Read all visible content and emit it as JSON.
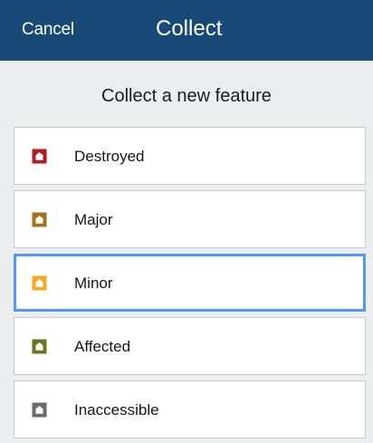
{
  "header": {
    "cancel_label": "Cancel",
    "title": "Collect"
  },
  "subtitle": "Collect a new feature",
  "features": [
    {
      "label": "Destroyed",
      "icon": "house-icon",
      "color": "#b31b24",
      "selected": false
    },
    {
      "label": "Major",
      "icon": "house-icon",
      "color": "#a8701e",
      "selected": false
    },
    {
      "label": "Minor",
      "icon": "house-icon",
      "color": "#f4a91f",
      "selected": true
    },
    {
      "label": "Affected",
      "icon": "house-icon",
      "color": "#6e7224",
      "selected": false
    },
    {
      "label": "Inaccessible",
      "icon": "house-icon",
      "color": "#6a6a6a",
      "selected": false
    }
  ],
  "colors": {
    "navbar": "#174a77",
    "background": "#ecedee",
    "selection_border": "#4e9cf0"
  }
}
